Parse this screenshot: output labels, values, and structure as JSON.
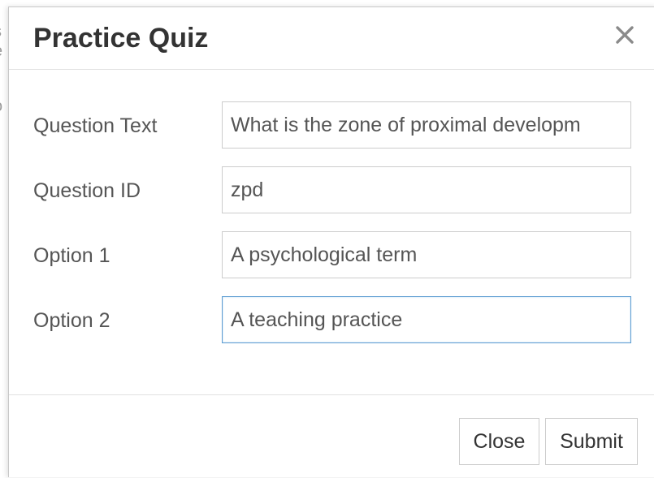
{
  "modal": {
    "title": "Practice Quiz"
  },
  "form": {
    "fields": [
      {
        "label": "Question Text",
        "value": "What is the zone of proximal developm"
      },
      {
        "label": "Question ID",
        "value": "zpd"
      },
      {
        "label": "Option 1",
        "value": "A psychological term"
      },
      {
        "label": "Option 2",
        "value": "A teaching practice"
      }
    ],
    "focused_field": "Option 2"
  },
  "footer": {
    "close_label": "Close",
    "submit_label": "Submit"
  },
  "icons": {
    "close": "close-icon"
  },
  "colors": {
    "title_text": "#333333",
    "label_text": "#555555",
    "input_border": "#cccccc",
    "focus_border": "#5b9bd1"
  }
}
